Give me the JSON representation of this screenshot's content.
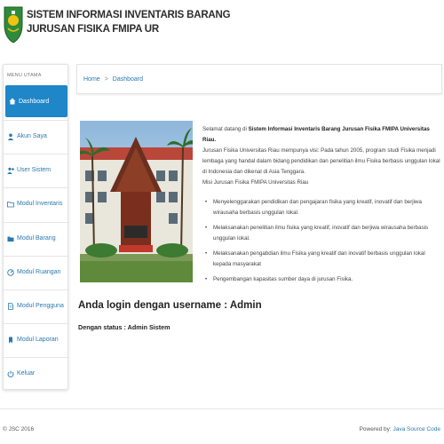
{
  "header": {
    "title": "SISTEM INFORMASI INVENTARIS BARANG",
    "subtitle": "JURUSAN FISIKA FMIPA UR"
  },
  "sidebar": {
    "heading": "MENU UTAMA",
    "items": [
      {
        "label": "Dashboard",
        "icon": "home-icon",
        "active": true
      },
      {
        "label": "Akun Saya",
        "icon": "user-icon"
      },
      {
        "label": "User Sistem",
        "icon": "user-plus-icon"
      },
      {
        "label": "Modul Inventaris",
        "icon": "folder-icon"
      },
      {
        "label": "Modul Barang",
        "icon": "folder-icon"
      },
      {
        "label": "Modul Ruangan",
        "icon": "gauge-icon"
      },
      {
        "label": "Modul Pengguna",
        "icon": "document-icon"
      },
      {
        "label": "Modul Laporan",
        "icon": "bookmark-icon"
      },
      {
        "label": "Keluar",
        "icon": "power-icon"
      }
    ]
  },
  "breadcrumb": {
    "home": "Home",
    "separator": ">",
    "current": "Dashboard"
  },
  "welcome": {
    "greeting_prefix": "Selamat datang di ",
    "greeting_bold": "Sistem Informasi Inventaris Barang Jurusan Fisika FMIPA Universitas Riau.",
    "visi": "Jurusan Fisika Universitas Riau mempunya visi: Pada tahun 2005, program studi Fisika menjadi lembaga yang handal dalam bidang pendidikan dan penelitian ilmu Fisika berbasis unggulan lokal di Indonesia dan dikenal di Asia Tenggara.",
    "misi_heading": "Misi Jurusan Fisika FMIPA Universitas Riau",
    "misi": [
      "Menyelenggarakan pendidikan dan pengajaran fisika yang kreatif, inovatif dan berjiwa wirausaha berbasis unggulan lokal.",
      "Melaksanakan penelitian ilmu fisika yang kreatif, inovatif dan berjiwa wirausaha berbasis unggulan lokal.",
      "Melaksanakan pengabdian ilmu Fisika yang kreatif dan inovatif berbasis unggulan lokal kepada masyarakat",
      "Pengembangan kapasitas sumber daya di jurusan Fisika."
    ]
  },
  "login": {
    "title": "Anda login dengan username : Admin",
    "status": "Dengan status : Admin Sistem"
  },
  "footer": {
    "copyright": "© JSC 2016",
    "powered_prefix": "Powered by: ",
    "powered_link": "Java Source Code"
  },
  "colors": {
    "accent": "#1f86c7",
    "link": "#2a7ab0"
  }
}
